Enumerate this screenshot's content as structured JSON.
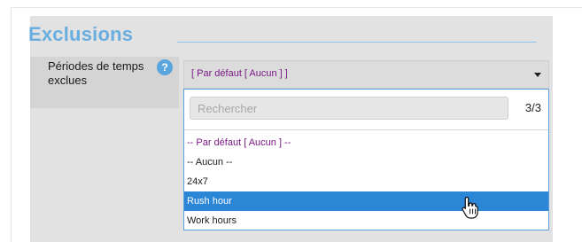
{
  "section": {
    "title": "Exclusions"
  },
  "field": {
    "label": "Périodes de temps exclues",
    "help_icon": "question-mark-icon",
    "help_symbol": "?"
  },
  "select": {
    "value": "[ Par défaut [ Aucun ] ]",
    "arrow_icon": "caret-down-icon"
  },
  "search": {
    "placeholder": "Rechercher",
    "value": "",
    "count": "3/3"
  },
  "options": [
    {
      "label": "-- Par défaut [ Aucun ] --",
      "state": "default"
    },
    {
      "label": "-- Aucun --",
      "state": "normal"
    },
    {
      "label": "24x7",
      "state": "normal"
    },
    {
      "label": "Rush hour",
      "state": "highlighted"
    },
    {
      "label": "Work hours",
      "state": "normal"
    }
  ],
  "colors": {
    "title": "#6aaee0",
    "panel": "#e2e2e2",
    "accent": "#2b86d6",
    "default_option": "#7a1a86"
  },
  "cursor": {
    "icon": "hand-pointer-icon"
  }
}
